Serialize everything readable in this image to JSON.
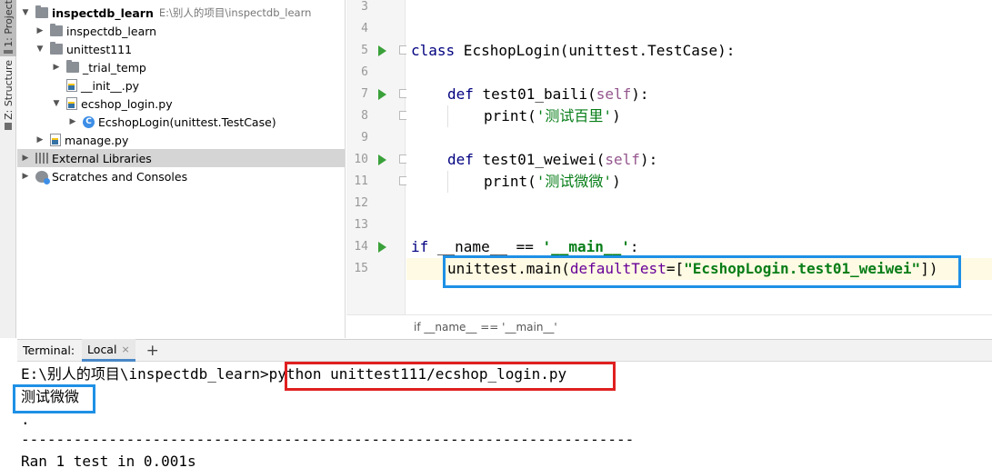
{
  "tool_strip": {
    "project_label": "1: Project",
    "structure_label": "Z: Structure"
  },
  "project_tree": {
    "root_name": "inspectdb_learn",
    "root_path": "E:\\别人的项目\\inspectdb_learn",
    "items": [
      {
        "label": "inspectdb_learn"
      },
      {
        "label": "unittest111"
      },
      {
        "label": "_trial_temp"
      },
      {
        "label": "__init__.py"
      },
      {
        "label": "ecshop_login.py"
      },
      {
        "label": "EcshopLogin(unittest.TestCase)"
      },
      {
        "label": "manage.py"
      },
      {
        "label": "External Libraries"
      },
      {
        "label": "Scratches and Consoles"
      }
    ]
  },
  "editor": {
    "line_numbers": [
      "3",
      "4",
      "5",
      "6",
      "7",
      "8",
      "9",
      "10",
      "11",
      "12",
      "13",
      "14",
      "15"
    ],
    "code": {
      "l5_kw": "class",
      "l5_rest": " EcshopLogin(unittest.TestCase):",
      "l7_kw": "def",
      "l7_name": " test01_baili(",
      "l7_self": "self",
      "l7_end": "):",
      "l8_fn": "print(",
      "l8_str": "'测试百里'",
      "l8_end": ")",
      "l10_kw": "def",
      "l10_name": " test01_weiwei(",
      "l10_self": "self",
      "l10_end": "):",
      "l11_fn": "print(",
      "l11_str": "'测试微微'",
      "l11_end": ")",
      "l14_kw": "if",
      "l14_mid": " __name__ == ",
      "l14_str": "'__main__'",
      "l14_end": ":",
      "l15_a": "unittest.main(",
      "l15_param": "defaultTest",
      "l15_b": "=[",
      "l15_str": "\"EcshopLogin.test01_weiwei\"",
      "l15_end": "])"
    },
    "breadcrumb": "if __name__ == '__main__'"
  },
  "terminal": {
    "label": "Terminal:",
    "tab_label": "Local",
    "close_glyph": "×",
    "add_glyph": "+",
    "lines": {
      "prompt": "E:\\别人的项目\\inspectdb_learn>",
      "command": "python unittest111/ecshop_login.py",
      "output1": "测试微微",
      "dot": ".",
      "separator": "----------------------------------------------------------------------",
      "ran": "Ran 1 test in 0.001s"
    }
  },
  "colors": {
    "highlight_blue": "#1e90e6",
    "highlight_red": "#e02020",
    "run_green": "#3aa13a"
  }
}
